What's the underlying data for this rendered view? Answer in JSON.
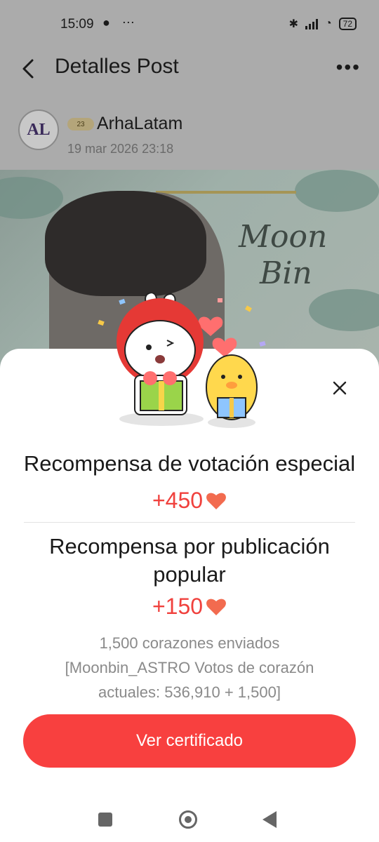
{
  "status_bar": {
    "time": "15:09",
    "left_icons": "● ⋯",
    "battery": "72"
  },
  "header": {
    "title": "Detalles Post",
    "more": "•••"
  },
  "author": {
    "avatar_text": "AL",
    "badge": "23",
    "name": "ArhaLatam",
    "date": "19 mar 2026 23:18"
  },
  "post_image": {
    "script_text_1": "Moon",
    "script_text_2": "Bin"
  },
  "sheet": {
    "reward_1": {
      "title": "Recompensa de votación especial",
      "amount": "+450"
    },
    "reward_2": {
      "title_line_1": "Recompensa por publicación",
      "title_line_2": "popular",
      "amount": "+150"
    },
    "info_line_1": "1,500 corazones enviados",
    "info_line_2": "[Moonbin_ASTRO Votos de corazón",
    "info_line_3": "actuales: 536,910 + 1,500]",
    "button_label": "Ver certificado"
  },
  "icons": {
    "back": "back-arrow-icon",
    "more": "more-dots-icon",
    "close": "close-icon",
    "heart": "heart-icon"
  },
  "colors": {
    "accent": "#f8403f",
    "heart": "#f0413d",
    "overlay": "#ababab"
  }
}
